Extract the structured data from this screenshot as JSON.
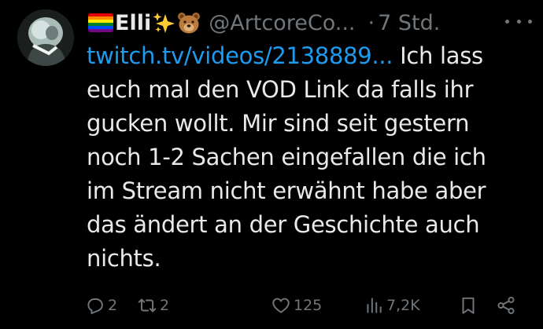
{
  "author": {
    "display_name": "Elli",
    "handle": "@ArtcoreCo...",
    "separator": "·",
    "time": "7 Std.",
    "badges": [
      "rainbow-flag-icon",
      "sparkles-icon",
      "bear-face-icon"
    ]
  },
  "tweet": {
    "link_text": "twitch.tv/videos/2138889...",
    "body_lines": [
      " Ich lass",
      "euch mal den VOD Link da falls ihr",
      "gucken wollt. Mir sind seit gestern",
      "noch 1-2 Sachen eingefallen die ich",
      "im Stream nicht erwähnt habe aber",
      "das ändert an der Geschichte auch",
      "nichts."
    ]
  },
  "actions": {
    "reply_count": "2",
    "retweet_count": "2",
    "like_count": "125",
    "view_count": "7,2K"
  },
  "colors": {
    "background": "#000000",
    "text": "#e7e9ea",
    "secondary": "#71767b",
    "link": "#1d9bf0"
  }
}
